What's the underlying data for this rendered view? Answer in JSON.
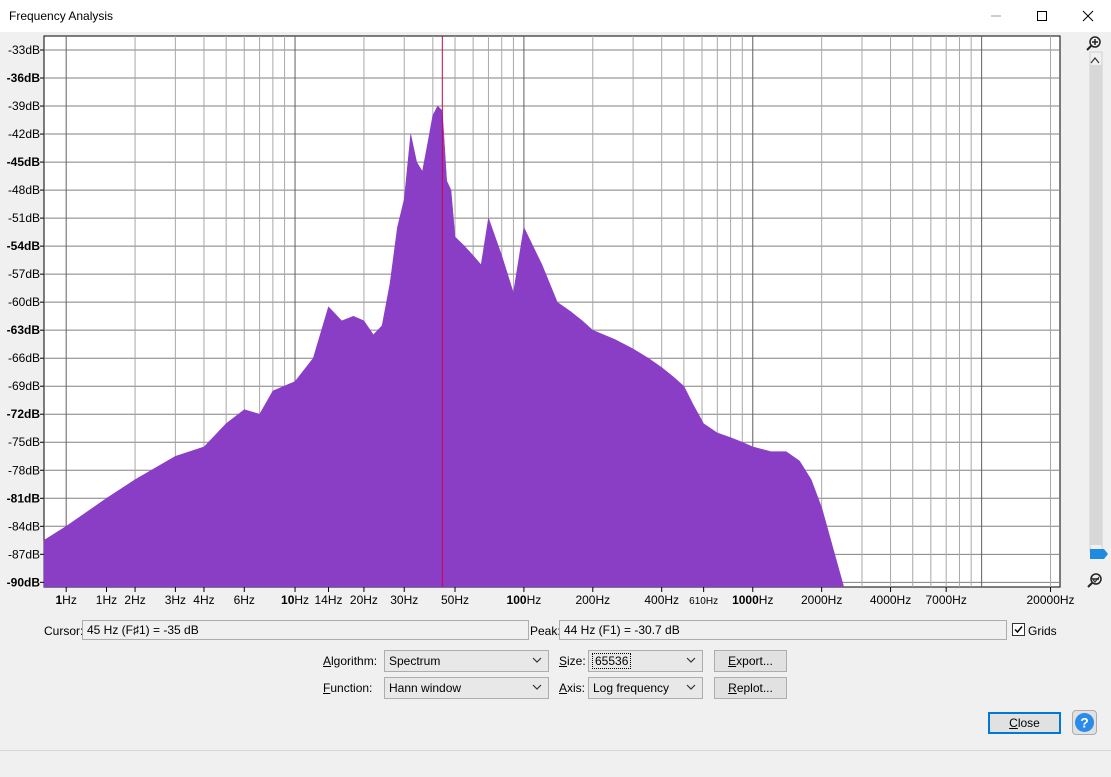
{
  "window": {
    "title": "Frequency Analysis"
  },
  "plot": {
    "fill_color": "#8a3ec6",
    "cursor_color": "#d0004a",
    "y_ticks": [
      "-33dB",
      "-36dB",
      "-39dB",
      "-42dB",
      "-45dB",
      "-48dB",
      "-51dB",
      "-54dB",
      "-57dB",
      "-60dB",
      "-63dB",
      "-66dB",
      "-69dB",
      "-72dB",
      "-75dB",
      "-78dB",
      "-81dB",
      "-84dB",
      "-87dB",
      "-90dB"
    ],
    "x_ticks": [
      {
        "major": "1",
        "unit": "Hz",
        "f": 1
      },
      {
        "label": "1Hz",
        "f": 1.5
      },
      {
        "label": "2Hz",
        "f": 2
      },
      {
        "label": "3Hz",
        "f": 3
      },
      {
        "label": "4Hz",
        "f": 4
      },
      {
        "label": "6Hz",
        "f": 6
      },
      {
        "major": "10",
        "unit": "Hz",
        "f": 10
      },
      {
        "label": "14Hz",
        "f": 14
      },
      {
        "label": "20Hz",
        "f": 20
      },
      {
        "label": "30Hz",
        "f": 30
      },
      {
        "label": "50Hz",
        "f": 50
      },
      {
        "major": "100",
        "unit": "Hz",
        "f": 100
      },
      {
        "label": "200Hz",
        "f": 200
      },
      {
        "label": "400Hz",
        "f": 400
      },
      {
        "label": "610Hz",
        "f": 610
      },
      {
        "major": "1000",
        "unit": "Hz",
        "f": 1000
      },
      {
        "label": "2000Hz",
        "f": 2000
      },
      {
        "label": "4000Hz",
        "f": 4000
      },
      {
        "label": "7000Hz",
        "f": 7000
      },
      {
        "label": "20000Hz",
        "f": 20000
      }
    ]
  },
  "chart_data": {
    "type": "area",
    "xscale": "log",
    "xlim": [
      0.8,
      22000
    ],
    "ylim": [
      -90.5,
      -31.5
    ],
    "grid": true,
    "cursor_x_hz": 44,
    "x": [
      0.8,
      1,
      1.5,
      2,
      3,
      4,
      5,
      6,
      7,
      8,
      10,
      12,
      14,
      16,
      18,
      20,
      22,
      24,
      26,
      28,
      30,
      32,
      34,
      36,
      38,
      40,
      42,
      44,
      46,
      48,
      50,
      55,
      60,
      65,
      70,
      80,
      90,
      100,
      120,
      140,
      160,
      180,
      200,
      250,
      300,
      350,
      400,
      450,
      500,
      550,
      610,
      700,
      800,
      900,
      1000,
      1200,
      1400,
      1600,
      1800,
      2000,
      2500,
      3000,
      3500,
      4000,
      4500,
      5000,
      6000,
      7000,
      8000,
      9000,
      10000,
      12000,
      14000,
      16000,
      18000,
      20000
    ],
    "y": [
      -85.5,
      -84,
      -81,
      -79,
      -76.5,
      -75.5,
      -73,
      -71.5,
      -72,
      -69.5,
      -68.5,
      -66,
      -60.5,
      -62,
      -61.5,
      -62,
      -63.5,
      -62.5,
      -58,
      -52,
      -49,
      -42,
      -45,
      -46,
      -43,
      -40,
      -39,
      -39.5,
      -47,
      -48,
      -53,
      -54,
      -55,
      -56,
      -51,
      -55,
      -59,
      -52,
      -56,
      -60,
      -61,
      -62,
      -63,
      -64,
      -65,
      -66,
      -67,
      -68,
      -69,
      -71,
      -73,
      -74,
      -74.5,
      -75,
      -75.5,
      -76,
      -76,
      -77,
      -79,
      -82,
      -90.5
    ]
  },
  "controls": {
    "cursor_label": "Cursor:",
    "cursor_value": "45 Hz (F♯1) = -35 dB",
    "peak_label": "Peak:",
    "peak_value": "44 Hz (F1) = -30.7 dB",
    "grids_label": "Grids",
    "grids_checked": true,
    "algorithm_label_u": "A",
    "algorithm_label_rest": "lgorithm:",
    "algorithm_value": "Spectrum",
    "function_label_u": "F",
    "function_label_rest": "unction:",
    "function_value": "Hann window",
    "size_label_u": "S",
    "size_label_rest": "ize:",
    "size_value": "65536",
    "axis_label_u": "A",
    "axis_label_rest": "xis:",
    "axis_value": "Log frequency",
    "export_u": "E",
    "export_rest": "xport...",
    "replot_u": "R",
    "replot_rest": "eplot...",
    "close_u": "C",
    "close_rest": "lose"
  }
}
